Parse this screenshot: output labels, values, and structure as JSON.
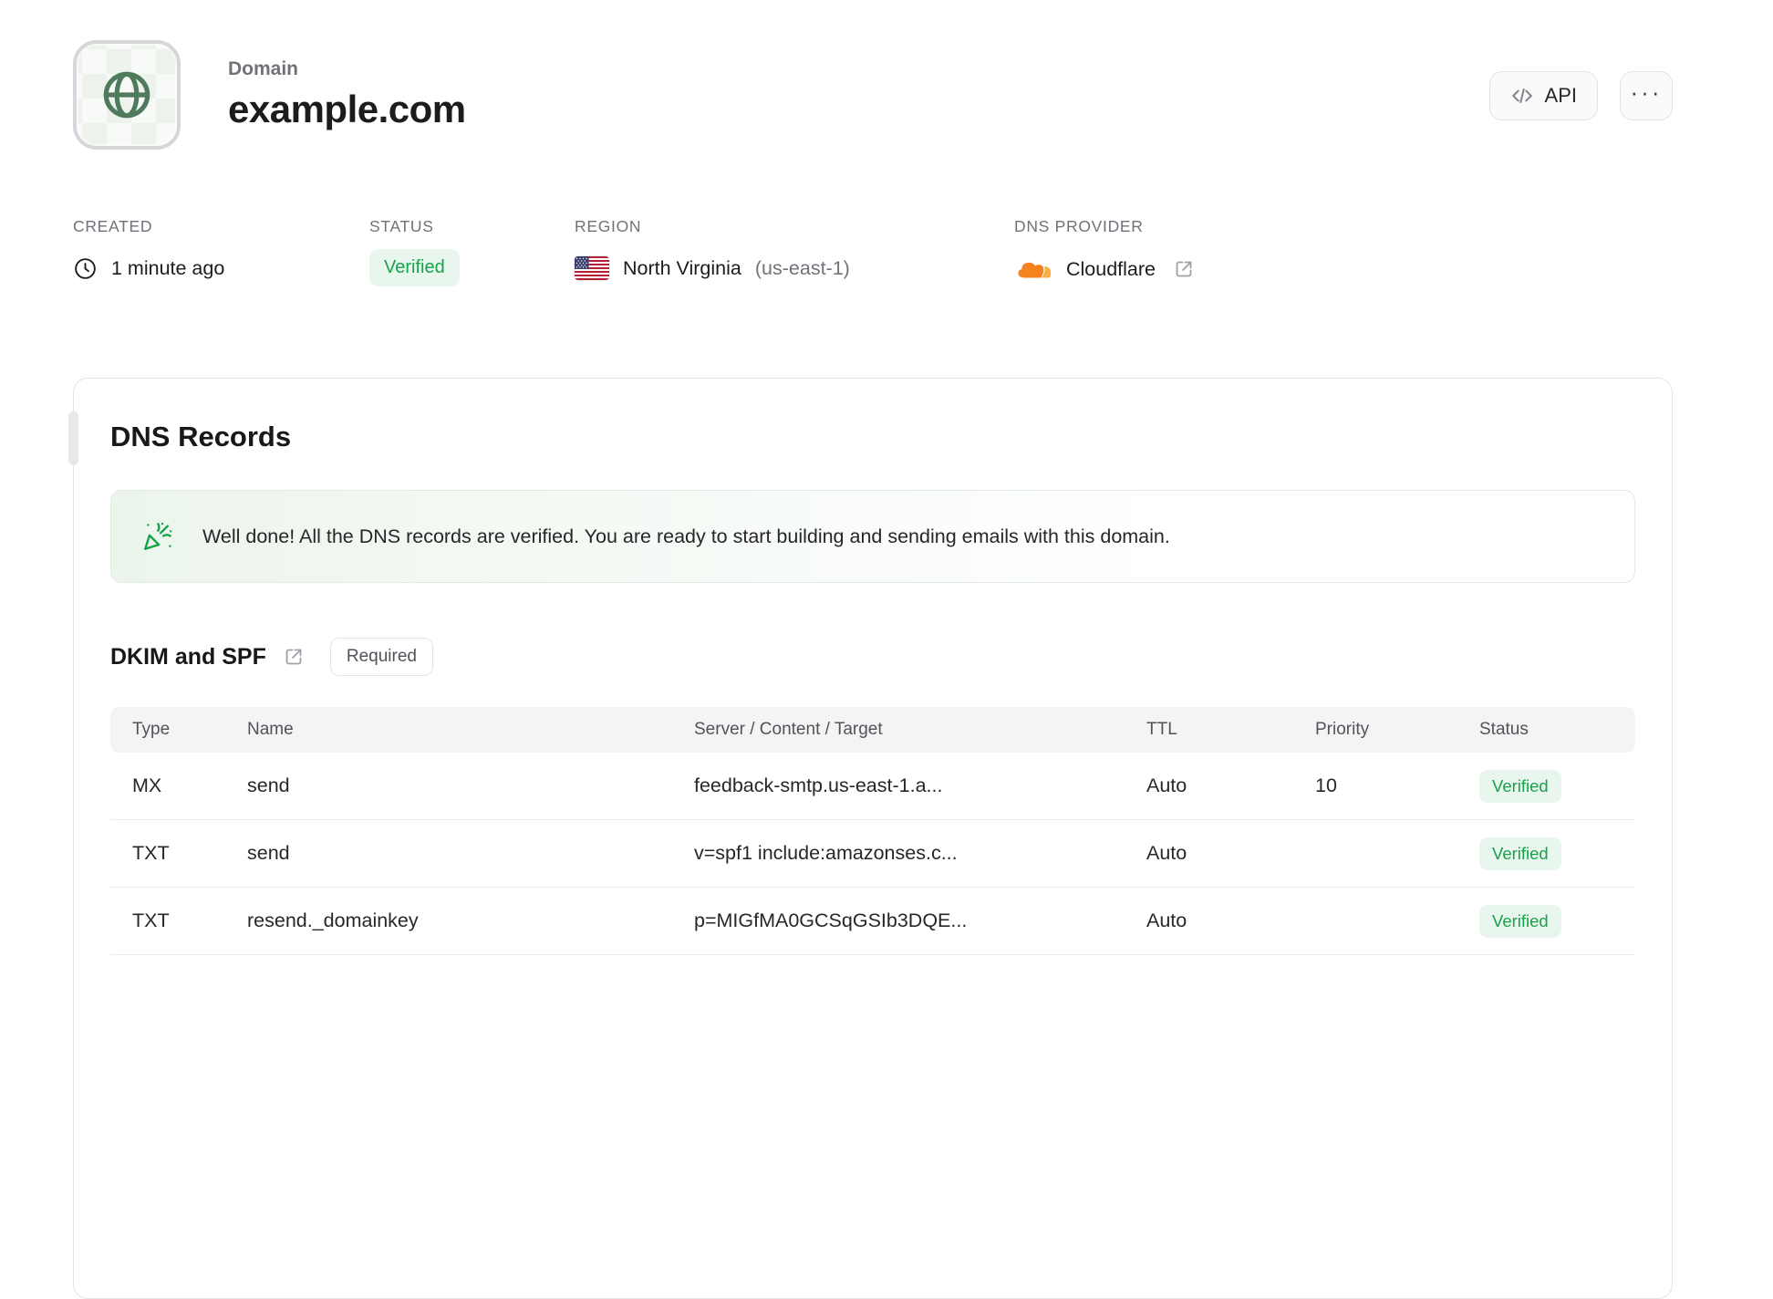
{
  "header": {
    "label": "Domain",
    "title": "example.com",
    "api_button": "API",
    "more_icon": "···"
  },
  "meta": {
    "created": {
      "label": "CREATED",
      "value": "1 minute ago"
    },
    "status": {
      "label": "STATUS",
      "value": "Verified"
    },
    "region": {
      "label": "REGION",
      "name": "North Virginia",
      "code": "(us-east-1)"
    },
    "dns_provider": {
      "label": "DNS PROVIDER",
      "value": "Cloudflare"
    }
  },
  "dns_card": {
    "title": "DNS Records",
    "banner": {
      "message": "Well done! All the DNS records are verified. You are ready to start building and sending emails with this domain."
    },
    "section": {
      "title": "DKIM and SPF",
      "badge": "Required"
    },
    "table": {
      "headers": [
        "Type",
        "Name",
        "Server / Content / Target",
        "TTL",
        "Priority",
        "Status"
      ],
      "rows": [
        {
          "type": "MX",
          "name": "send",
          "content": "feedback-smtp.us-east-1.a...",
          "ttl": "Auto",
          "priority": "10",
          "status": "Verified"
        },
        {
          "type": "TXT",
          "name": "send",
          "content": "v=spf1 include:amazonses.c...",
          "ttl": "Auto",
          "priority": "",
          "status": "Verified"
        },
        {
          "type": "TXT",
          "name": "resend._domainkey",
          "content": "p=MIGfMA0GCSqGSIb3DQE...",
          "ttl": "Auto",
          "priority": "",
          "status": "Verified"
        }
      ]
    }
  },
  "colors": {
    "accent_green": "#16a34a",
    "badge_bg": "#e9f6ee",
    "globe_green": "#4f7a5c",
    "cloudflare_orange": "#f6821f",
    "cloudflare_orange_light": "#fbad41",
    "flag_red": "#b22234",
    "flag_blue": "#3c3b6e"
  }
}
